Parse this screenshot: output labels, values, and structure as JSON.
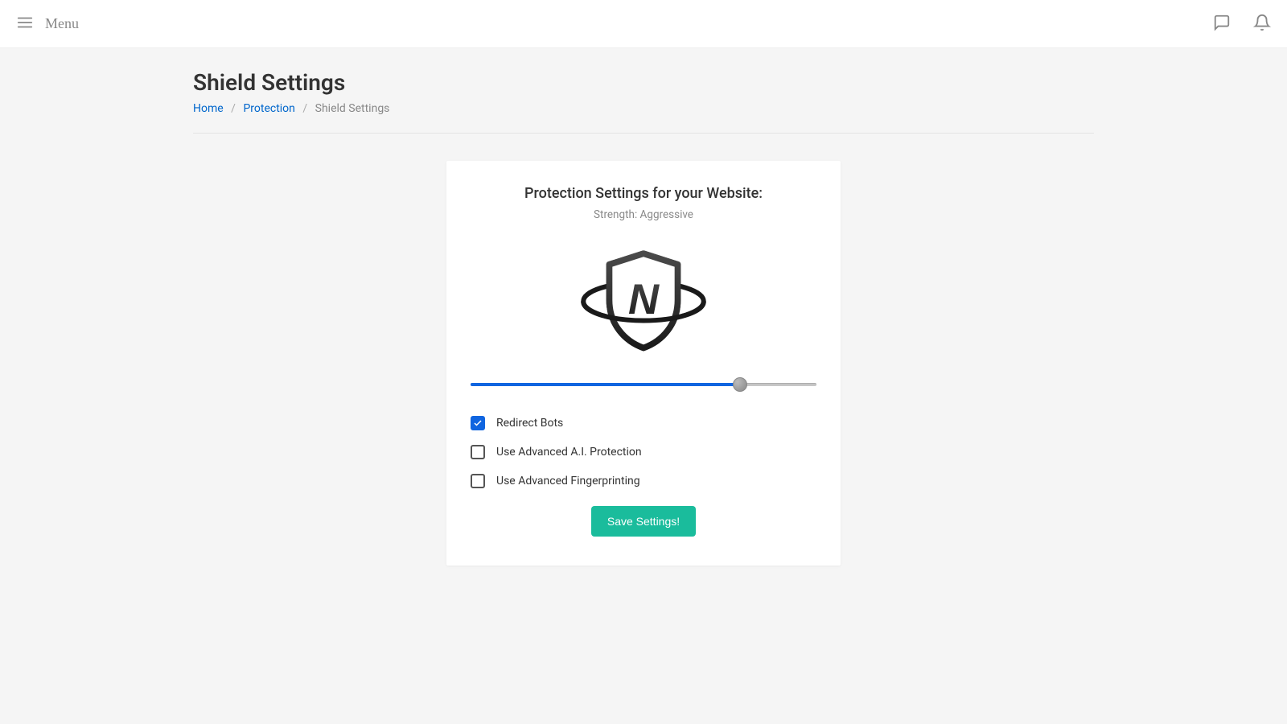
{
  "topbar": {
    "menu_label": "Menu"
  },
  "page": {
    "title": "Shield Settings"
  },
  "breadcrumb": {
    "home": "Home",
    "protection": "Protection",
    "current": "Shield Settings"
  },
  "card": {
    "title": "Protection Settings for your Website:",
    "subtitle": "Strength: Aggressive",
    "save_label": "Save Settings!"
  },
  "options": {
    "redirect_bots": {
      "label": "Redirect Bots",
      "checked": true
    },
    "ai_protection": {
      "label": "Use Advanced A.I. Protection",
      "checked": false
    },
    "fingerprinting": {
      "label": "Use Advanced Fingerprinting",
      "checked": false
    }
  },
  "slider": {
    "percent": 78
  }
}
